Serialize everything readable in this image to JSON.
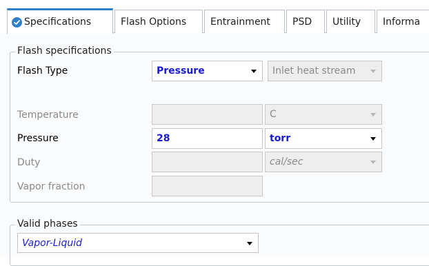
{
  "tabs": [
    {
      "label": "Specifications",
      "active": true
    },
    {
      "label": "Flash Options",
      "active": false
    },
    {
      "label": "Entrainment",
      "active": false
    },
    {
      "label": "PSD",
      "active": false
    },
    {
      "label": "Utility",
      "active": false
    },
    {
      "label": "Informa",
      "active": false
    }
  ],
  "flash": {
    "group_title": "Flash specifications",
    "flash_type_label": "Flash Type",
    "flash_type_value": "Pressure",
    "inlet_heat_stream": "Inlet heat stream",
    "temperature_label": "Temperature",
    "temperature_value": "",
    "temperature_unit": "C",
    "pressure_label": "Pressure",
    "pressure_value": "28",
    "pressure_unit": "torr",
    "duty_label": "Duty",
    "duty_value": "",
    "duty_unit": "cal/sec",
    "vapor_fraction_label": "Vapor fraction",
    "vapor_fraction_value": ""
  },
  "phases": {
    "group_title": "Valid phases",
    "value": "Vapor-Liquid"
  },
  "colors": {
    "active_tab_accent": "#2f7fc9",
    "value_text": "#1a1ad0",
    "disabled_text": "#8a8a8a"
  },
  "icons": {
    "active_tab_icon": "check-circle-icon"
  }
}
